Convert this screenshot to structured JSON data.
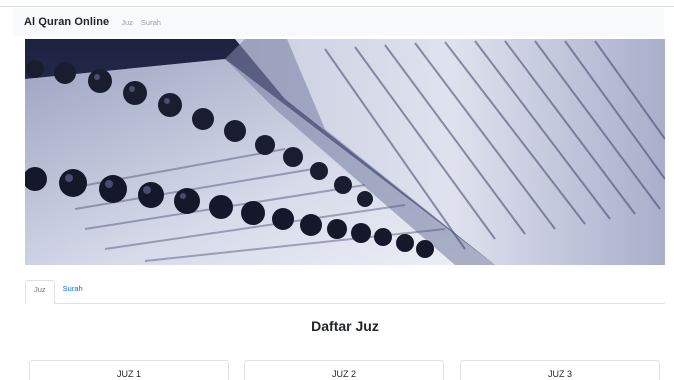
{
  "navbar": {
    "brand": "Al Quran Online",
    "links": [
      "Juz",
      "Surah"
    ]
  },
  "hero": {
    "image": "quran-with-prayer-beads"
  },
  "tabs": [
    {
      "label": "Juz",
      "active": true
    },
    {
      "label": "Surah",
      "active": false
    }
  ],
  "main": {
    "title": "Daftar Juz",
    "cards": [
      "JUZ 1",
      "JUZ 2",
      "JUZ 3"
    ]
  },
  "colors": {
    "navbar_bg": "#f8f9fa",
    "link_blue": "#0d6efd",
    "hero_tint": "#2a2f49"
  }
}
